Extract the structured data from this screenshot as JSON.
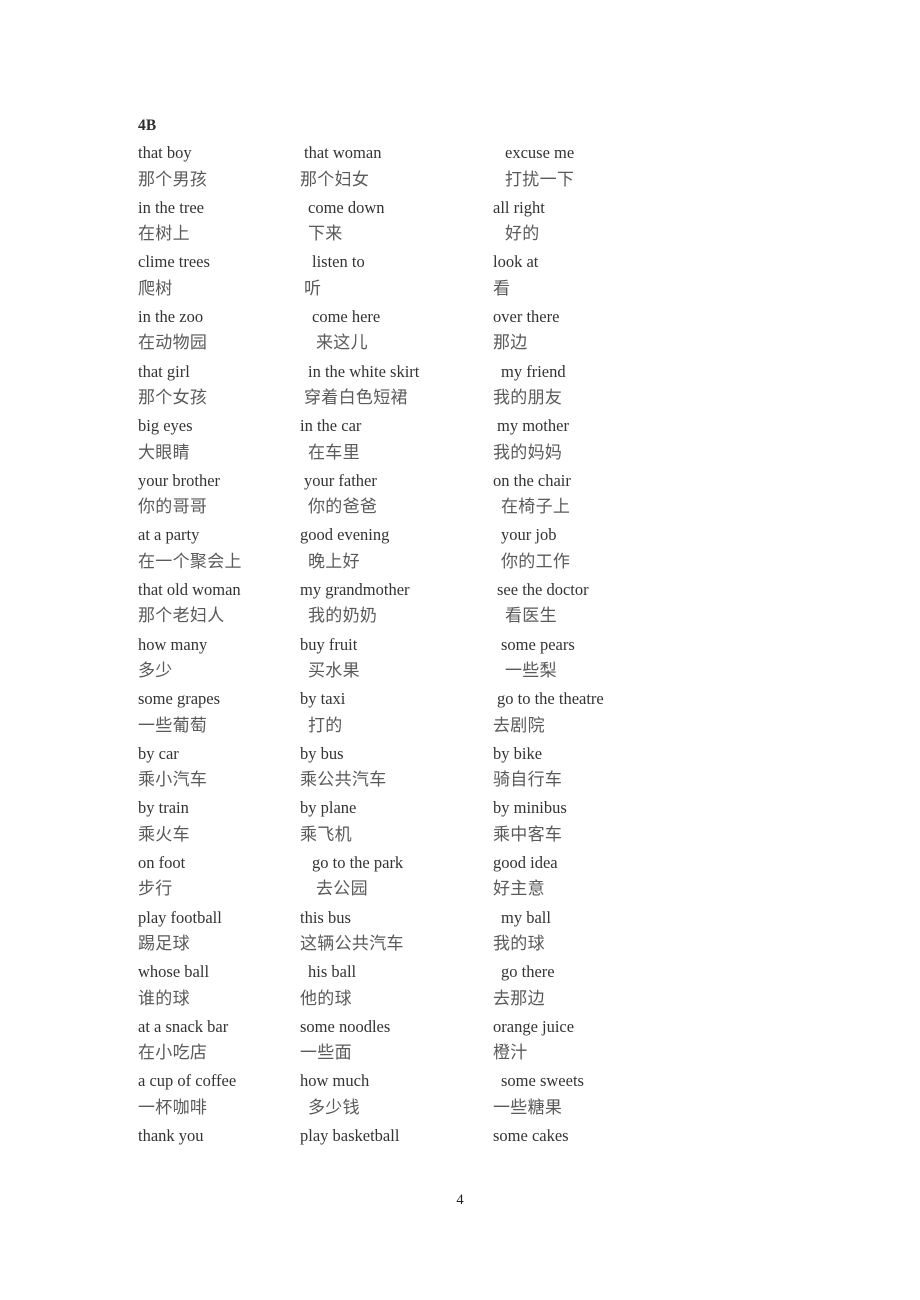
{
  "document": {
    "heading": "4B",
    "page_number": "4"
  },
  "columns": [
    {
      "name": "column-1",
      "entries": [
        {
          "en": "that boy",
          "zh": "那个男孩",
          "en_indent": 0,
          "zh_indent": 0
        },
        {
          "en": "in the tree",
          "zh": "在树上",
          "en_indent": 0,
          "zh_indent": 0
        },
        {
          "en": "clime trees",
          "zh": "爬树",
          "en_indent": 0,
          "zh_indent": 0
        },
        {
          "en": "in the zoo",
          "zh": "在动物园",
          "en_indent": 0,
          "zh_indent": 0
        },
        {
          "en": "that girl",
          "zh": "那个女孩",
          "en_indent": 0,
          "zh_indent": 0
        },
        {
          "en": "big eyes",
          "zh": "大眼睛",
          "en_indent": 0,
          "zh_indent": 0
        },
        {
          "en": "your brother",
          "zh": "你的哥哥",
          "en_indent": 0,
          "zh_indent": 0
        },
        {
          "en": "at a party",
          "zh": "在一个聚会上",
          "en_indent": 0,
          "zh_indent": 0
        },
        {
          "en": "that old woman",
          "zh": "那个老妇人",
          "en_indent": 0,
          "zh_indent": 0
        },
        {
          "en": "how many",
          "zh": "多少",
          "en_indent": 0,
          "zh_indent": 0
        },
        {
          "en": "some grapes",
          "zh": "一些葡萄",
          "en_indent": 0,
          "zh_indent": 0
        },
        {
          "en": "by car",
          "zh": "乘小汽车",
          "en_indent": 0,
          "zh_indent": 0
        },
        {
          "en": "by train",
          "zh": "乘火车",
          "en_indent": 0,
          "zh_indent": 0
        },
        {
          "en": "on foot",
          "zh": "步行",
          "en_indent": 0,
          "zh_indent": 0
        },
        {
          "en": "play football",
          "zh": "踢足球",
          "en_indent": 0,
          "zh_indent": 0
        },
        {
          "en": "whose ball",
          "zh": "谁的球",
          "en_indent": 0,
          "zh_indent": 0
        },
        {
          "en": "at a snack bar",
          "zh": "在小吃店",
          "en_indent": 0,
          "zh_indent": 0
        },
        {
          "en": "a cup of coffee",
          "zh": "一杯咖啡",
          "en_indent": 0,
          "zh_indent": 0
        },
        {
          "en": "thank you",
          "zh": "",
          "en_indent": 0,
          "zh_indent": 0
        }
      ]
    },
    {
      "name": "column-2",
      "entries": [
        {
          "en": "that woman",
          "zh": "那个妇女",
          "en_indent": 1,
          "zh_indent": 0
        },
        {
          "en": "come down",
          "zh": "下来",
          "en_indent": 2,
          "zh_indent": 2
        },
        {
          "en": "listen to",
          "zh": "听",
          "en_indent": 3,
          "zh_indent": 1
        },
        {
          "en": "come here",
          "zh": "来这儿",
          "en_indent": 3,
          "zh_indent": 4
        },
        {
          "en": "in the white skirt",
          "zh": "穿着白色短裙",
          "en_indent": 2,
          "zh_indent": 1
        },
        {
          "en": "in the car",
          "zh": "在车里",
          "en_indent": 0,
          "zh_indent": 2
        },
        {
          "en": "your father",
          "zh": "你的爸爸",
          "en_indent": 1,
          "zh_indent": 2
        },
        {
          "en": "good evening",
          "zh": "晚上好",
          "en_indent": 0,
          "zh_indent": 2
        },
        {
          "en": "my grandmother",
          "zh": "我的奶奶",
          "en_indent": 0,
          "zh_indent": 2
        },
        {
          "en": "buy fruit",
          "zh": "买水果",
          "en_indent": 0,
          "zh_indent": 2
        },
        {
          "en": "by taxi",
          "zh": "打的",
          "en_indent": 0,
          "zh_indent": 2
        },
        {
          "en": "by bus",
          "zh": "乘公共汽车",
          "en_indent": 0,
          "zh_indent": 0
        },
        {
          "en": "by plane",
          "zh": "乘飞机",
          "en_indent": 0,
          "zh_indent": 0
        },
        {
          "en": "go to the park",
          "zh": "去公园",
          "en_indent": 3,
          "zh_indent": 4
        },
        {
          "en": "this bus",
          "zh": "这辆公共汽车",
          "en_indent": 0,
          "zh_indent": 0
        },
        {
          "en": "his ball",
          "zh": "他的球",
          "en_indent": 2,
          "zh_indent": 0
        },
        {
          "en": "some noodles",
          "zh": "一些面",
          "en_indent": 0,
          "zh_indent": 0
        },
        {
          "en": "how much",
          "zh": "多少钱",
          "en_indent": 0,
          "zh_indent": 2
        },
        {
          "en": "play basketball",
          "zh": "",
          "en_indent": 0,
          "zh_indent": 0
        }
      ]
    },
    {
      "name": "column-3",
      "entries": [
        {
          "en": "excuse me",
          "zh": "打扰一下",
          "en_indent": 3,
          "zh_indent": 3
        },
        {
          "en": "all right",
          "zh": "好的",
          "en_indent": 0,
          "zh_indent": 3
        },
        {
          "en": "look at",
          "zh": "看",
          "en_indent": 0,
          "zh_indent": 0
        },
        {
          "en": "over there",
          "zh": "那边",
          "en_indent": 0,
          "zh_indent": 0
        },
        {
          "en": "my friend",
          "zh": "我的朋友",
          "en_indent": 2,
          "zh_indent": 0
        },
        {
          "en": "my mother",
          "zh": "我的妈妈",
          "en_indent": 1,
          "zh_indent": 0
        },
        {
          "en": "on the chair",
          "zh": "在椅子上",
          "en_indent": 0,
          "zh_indent": 2
        },
        {
          "en": "your job",
          "zh": "你的工作",
          "en_indent": 2,
          "zh_indent": 2
        },
        {
          "en": "see the doctor",
          "zh": "看医生",
          "en_indent": 1,
          "zh_indent": 3
        },
        {
          "en": "some pears",
          "zh": "一些梨",
          "en_indent": 2,
          "zh_indent": 3
        },
        {
          "en": "go to the theatre",
          "zh": "去剧院",
          "en_indent": 1,
          "zh_indent": 0
        },
        {
          "en": "by bike",
          "zh": "骑自行车",
          "en_indent": 0,
          "zh_indent": 0
        },
        {
          "en": "by minibus",
          "zh": "乘中客车",
          "en_indent": 0,
          "zh_indent": 0
        },
        {
          "en": "good idea",
          "zh": "好主意",
          "en_indent": 0,
          "zh_indent": 0
        },
        {
          "en": "my ball",
          "zh": "我的球",
          "en_indent": 2,
          "zh_indent": 0
        },
        {
          "en": "go there",
          "zh": "去那边",
          "en_indent": 2,
          "zh_indent": 0
        },
        {
          "en": "orange juice",
          "zh": "橙汁",
          "en_indent": 0,
          "zh_indent": 0
        },
        {
          "en": "some sweets",
          "zh": "一些糖果",
          "en_indent": 2,
          "zh_indent": 0
        },
        {
          "en": "some cakes",
          "zh": "",
          "en_indent": 0,
          "zh_indent": 0
        }
      ]
    }
  ]
}
